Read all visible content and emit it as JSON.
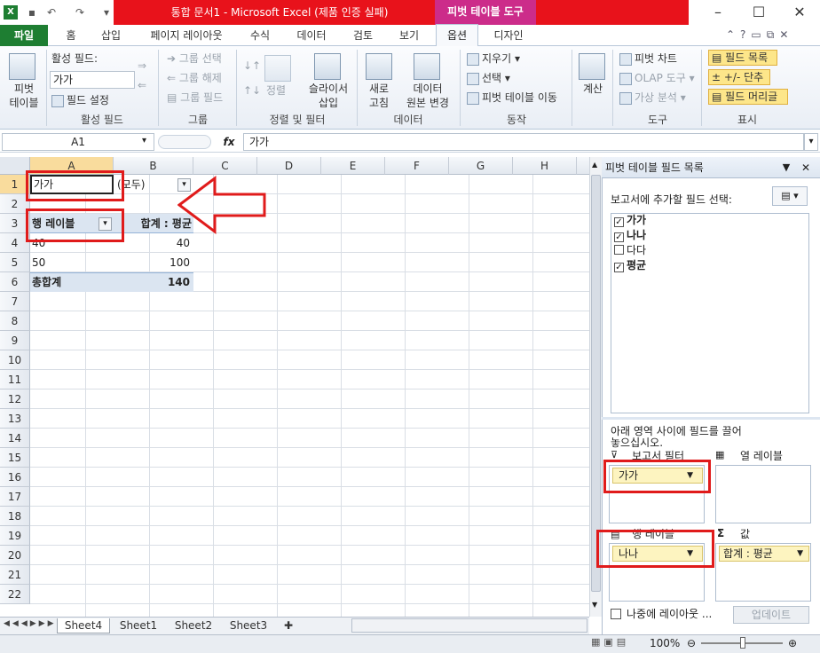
{
  "window": {
    "title": "통합 문서1 - Microsoft Excel (제품 인증 실패)",
    "context_tab": "피벗 테이블 도구"
  },
  "tabs": {
    "file": "파일",
    "home": "홈",
    "insert": "삽입",
    "page_layout": "페이지 레이아웃",
    "formulas": "수식",
    "data": "데이터",
    "review": "검토",
    "view": "보기",
    "options": "옵션",
    "design": "디자인"
  },
  "ribbon": {
    "pivot_table": "피벗\n테이블",
    "active_field_title": "활성 필드:",
    "active_field_value": "가가",
    "field_settings": "필드 설정",
    "group_active_field": "활성 필드",
    "group_selection": "그룹 선택",
    "ungroup": "그룹 해제",
    "group_field": "그룹 필드",
    "group_group": "그룹",
    "sort": "정렬",
    "slicer_insert": "슬라이서\n삽입",
    "group_sort_filter": "정렬 및 필터",
    "refresh": "새로\n고침",
    "change_source": "데이터\n원본 변경",
    "group_data": "데이터",
    "clear": "지우기",
    "select": "선택",
    "move_pivot": "피벗 테이블 이동",
    "group_actions": "동작",
    "calculations": "계산",
    "pivot_chart": "피벗 차트",
    "olap_tools": "OLAP 도구",
    "what_if": "가상 분석",
    "group_tools": "도구",
    "field_list": "필드 목록",
    "buttons": "+/- 단추",
    "field_headers": "필드 머리글",
    "group_show": "표시"
  },
  "formula_bar": {
    "name_box": "A1",
    "fx": "fx",
    "content": "가가"
  },
  "grid": {
    "columns": [
      "A",
      "B",
      "C",
      "D",
      "E",
      "F",
      "G",
      "H"
    ],
    "rows": [
      "1",
      "2",
      "3",
      "4",
      "5",
      "6",
      "7",
      "8",
      "9",
      "10",
      "11",
      "12",
      "13",
      "14",
      "15",
      "16",
      "17",
      "18",
      "19",
      "20",
      "21",
      "22"
    ],
    "a1": "가가",
    "b1": "(모두)",
    "a3": "행 레이블",
    "b3": "합계 : 평균",
    "a4": "40",
    "b4": "40",
    "a5": "50",
    "b5": "100",
    "a6": "총합계",
    "b6": "140"
  },
  "sheets": [
    "Sheet4",
    "Sheet1",
    "Sheet2",
    "Sheet3"
  ],
  "status": {
    "zoom": "100%"
  },
  "panel": {
    "title": "피벗 테이블 필드 목록",
    "choose_fields": "보고서에 추가할 필드 선택:",
    "fields": [
      {
        "name": "가가",
        "checked": true
      },
      {
        "name": "나나",
        "checked": true
      },
      {
        "name": "다다",
        "checked": false
      },
      {
        "name": "평균",
        "checked": true
      }
    ],
    "drag_hint": "아래 영역 사이에 필드를 끌어 놓으십시오.",
    "report_filter": "보고서 필터",
    "column_labels": "열 레이블",
    "row_labels": "행 레이블",
    "values": "값",
    "filter_pill": "가가",
    "row_pill": "나나",
    "values_pill": "합계 : 평균",
    "defer_update": "나중에 레이아웃 ...",
    "update": "업데이트"
  },
  "colors": {
    "excel_green": "#1e7e32",
    "title_red": "#e8121b",
    "pivot_magenta": "#cc2c8a",
    "annotation_red": "#e01b1b"
  }
}
